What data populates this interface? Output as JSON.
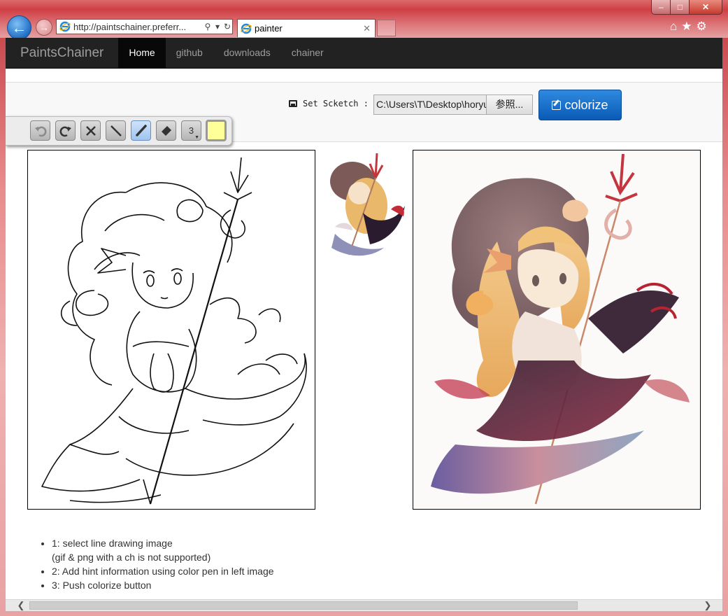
{
  "browser": {
    "address_url": "http://paintschainer.preferr...",
    "tab_title": "painter",
    "tab_close": "✕",
    "win_min": "–",
    "win_max": "□",
    "win_close": "✕"
  },
  "navbar": {
    "brand": "PaintsChainer",
    "links": [
      "Home",
      "github",
      "downloads",
      "chainer"
    ],
    "active": "Home"
  },
  "upload": {
    "label": "Set Scketch :",
    "file_path": "C:\\Users\\T\\Desktop\\horyu",
    "browse_button": "参照...",
    "colorize_button": "colorize"
  },
  "toolbar": {
    "tools": [
      "undo-icon",
      "redo-icon",
      "clear-icon",
      "line-icon",
      "pen-icon",
      "eraser-icon"
    ],
    "brush_size": "3",
    "selected_tool": "pen-icon",
    "color": "#ffff99"
  },
  "instructions": {
    "step1": "1: select line drawing image",
    "step1_note": "(gif & png with a ch is not supported)",
    "step2": "2: Add hint information using color pen in left image",
    "step3": "3: Push colorize button"
  },
  "colors": {
    "navbar_bg": "#222222",
    "colorize_bg": "#0a5ab5",
    "window_frame": "#cf3f44"
  }
}
